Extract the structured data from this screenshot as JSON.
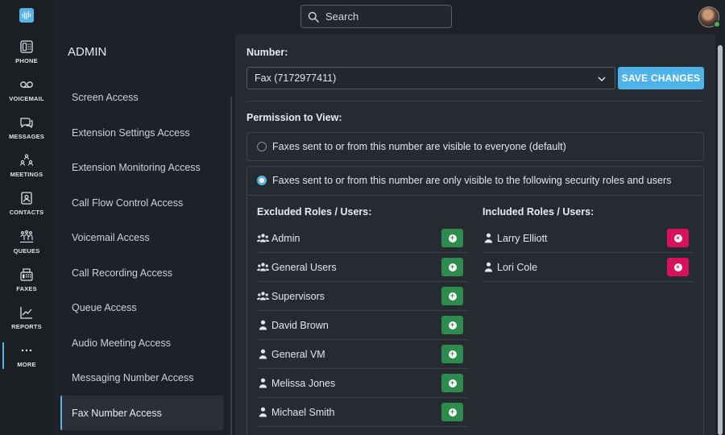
{
  "topbar": {
    "search_placeholder": "Search"
  },
  "rail": {
    "items": [
      {
        "label": "PHONE",
        "icon": "phone-icon"
      },
      {
        "label": "VOICEMAIL",
        "icon": "voicemail-icon"
      },
      {
        "label": "MESSAGES",
        "icon": "messages-icon"
      },
      {
        "label": "MEETINGS",
        "icon": "meetings-icon"
      },
      {
        "label": "CONTACTS",
        "icon": "contacts-icon"
      },
      {
        "label": "QUEUES",
        "icon": "queues-icon"
      },
      {
        "label": "FAXES",
        "icon": "fax-icon"
      },
      {
        "label": "REPORTS",
        "icon": "reports-icon"
      },
      {
        "label": "MORE",
        "icon": "more-icon"
      }
    ]
  },
  "admin": {
    "title": "ADMIN",
    "items": [
      "Screen Access",
      "Extension Settings Access",
      "Extension Monitoring Access",
      "Call Flow Control Access",
      "Voicemail Access",
      "Call Recording Access",
      "Queue Access",
      "Audio Meeting Access",
      "Messaging Number Access",
      "Fax Number Access"
    ]
  },
  "main": {
    "number_label": "Number:",
    "number_value": "Fax (7172977411)",
    "save_label": "SAVE CHANGES",
    "permission_label": "Permission to View:",
    "option_everyone": "Faxes sent to or from this number are visible to everyone (default)",
    "option_restricted": "Faxes sent to or from this number are only visible to the following security roles and users",
    "excluded_header": "Excluded Roles / Users:",
    "included_header": "Included Roles / Users:",
    "excluded": [
      {
        "name": "Admin",
        "type": "group"
      },
      {
        "name": "General Users",
        "type": "group"
      },
      {
        "name": "Supervisors",
        "type": "group"
      },
      {
        "name": "David Brown",
        "type": "user"
      },
      {
        "name": "General VM",
        "type": "user"
      },
      {
        "name": "Melissa Jones",
        "type": "user"
      },
      {
        "name": "Michael Smith",
        "type": "user"
      }
    ],
    "included": [
      {
        "name": "Larry Elliott",
        "type": "user"
      },
      {
        "name": "Lori Cole",
        "type": "user"
      }
    ]
  },
  "colors": {
    "accent": "#5ab3e6",
    "add": "#2e8b4e",
    "remove": "#d7125a"
  }
}
